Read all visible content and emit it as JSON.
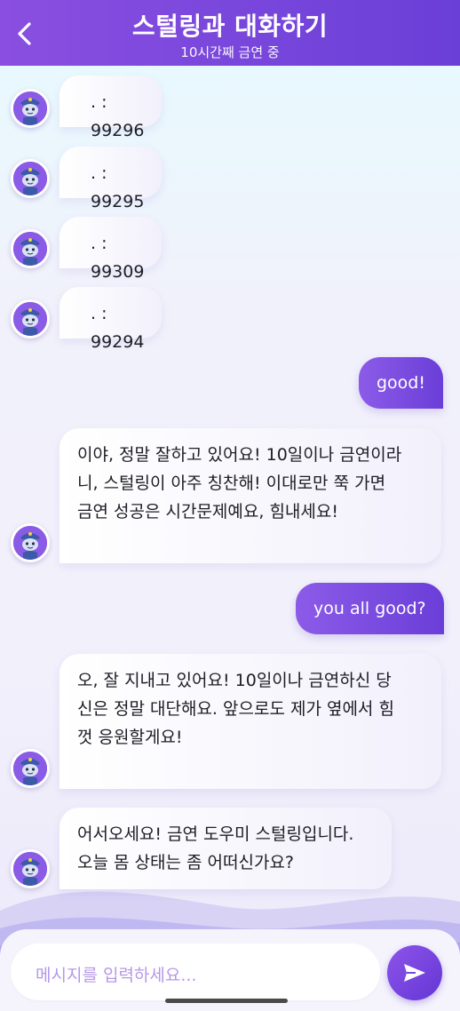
{
  "header": {
    "title": "스털링과 대화하기",
    "subtitle": "10시간째 금연 중"
  },
  "messages": [
    {
      "sender": "bot",
      "text": ". : 99296"
    },
    {
      "sender": "bot",
      "text": ". : 99295"
    },
    {
      "sender": "bot",
      "text": ". : 99309"
    },
    {
      "sender": "bot",
      "text": ". : 99294"
    },
    {
      "sender": "user",
      "text": "good!"
    },
    {
      "sender": "bot",
      "lines": [
        "이야, 정말 잘하고 있어요! 10일이나 금연이라",
        "니, 스털링이 아주 칭찬해! 이대로만 쭉 가면",
        "금연 성공은 시간문제예요, 힘내세요!"
      ]
    },
    {
      "sender": "user",
      "text": "you all good?"
    },
    {
      "sender": "bot",
      "lines": [
        "오, 잘 지내고 있어요! 10일이나 금연하신 당",
        "신은 정말 대단해요. 앞으로도 제가 옆에서 힘",
        "껏 응원할게요!"
      ]
    },
    {
      "sender": "bot",
      "lines": [
        "어서오세요! 금연 도우미 스털링입니다.",
        "오늘 몸 상태는 좀 어떠신가요?"
      ]
    }
  ],
  "input": {
    "placeholder": "메시지를 입력하세요..."
  },
  "icons": {
    "back": "chevron-left-icon",
    "send": "send-icon",
    "avatar": "police-mascot-avatar"
  },
  "colors": {
    "accent": "#7545dc",
    "placeholder": "#b697e8"
  }
}
